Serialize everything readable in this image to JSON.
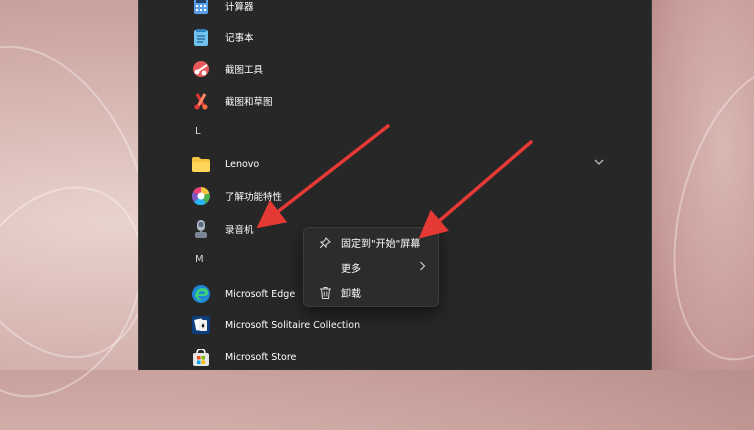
{
  "colors": {
    "panel_bg": "#272727",
    "menu_bg": "#2c2c2c",
    "annotation_arrow": "#e53935",
    "text": "#ffffff"
  },
  "start_menu": {
    "app_list": [
      {
        "label": "计算器",
        "icon": "calculator-icon"
      },
      {
        "label": "记事本",
        "icon": "notepad-icon"
      },
      {
        "label": "截图工具",
        "icon": "snipping-tool-icon"
      },
      {
        "label": "截图和草图",
        "icon": "snip-sketch-icon"
      }
    ],
    "section_l": "L",
    "lenovo": {
      "label": "Lenovo",
      "icon": "folder-icon",
      "expand": "chevron-down-icon"
    },
    "get_started": {
      "label": "了解功能特性",
      "icon": "get-started-icon"
    },
    "recorder": {
      "label": "录音机",
      "icon": "microphone-icon"
    },
    "section_m": "M",
    "m_items": [
      {
        "label": "Microsoft Edge",
        "icon": "edge-icon"
      },
      {
        "label": "Microsoft Solitaire Collection",
        "icon": "solitaire-icon"
      },
      {
        "label": "Microsoft Store",
        "icon": "store-icon"
      }
    ]
  },
  "context_menu": {
    "pin": {
      "label": "固定到\"开始\"屏幕",
      "icon": "pin-icon"
    },
    "more": {
      "label": "更多",
      "icon": "chevron-right-icon"
    },
    "uninstall": {
      "label": "卸载",
      "icon": "trash-icon"
    }
  }
}
